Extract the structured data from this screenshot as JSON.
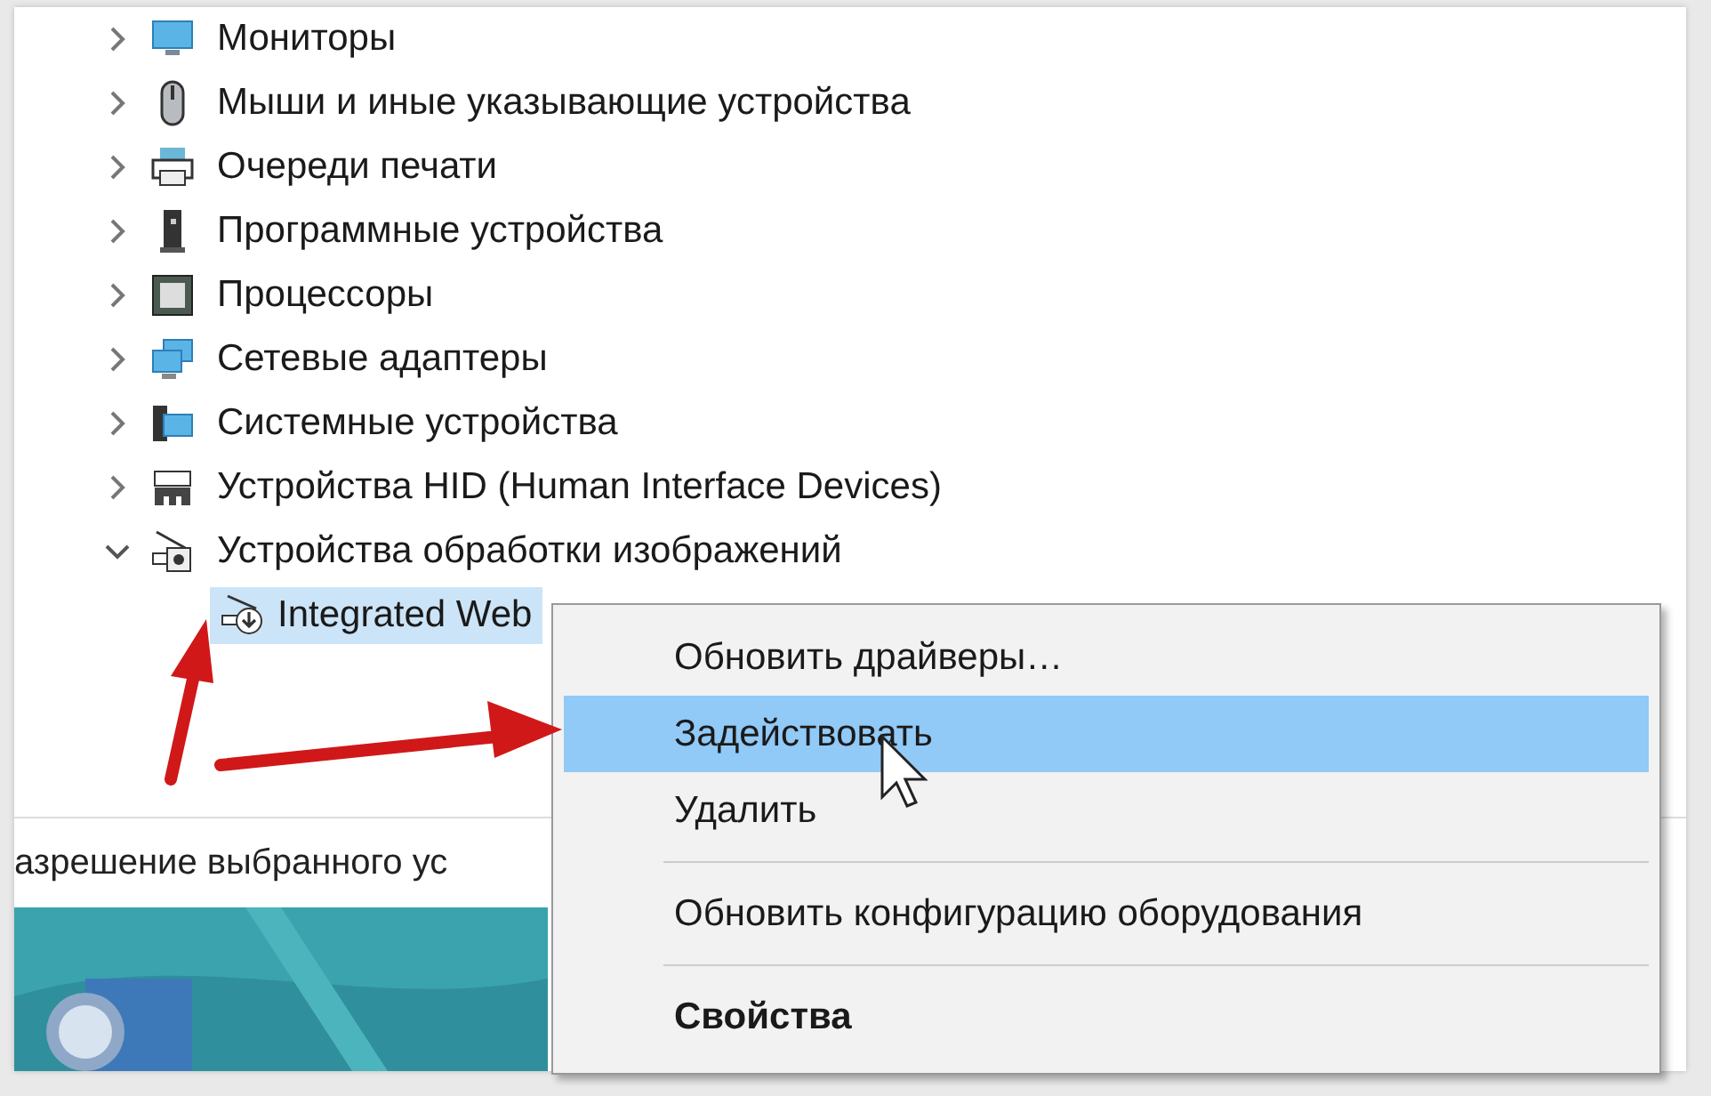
{
  "tree": {
    "items": [
      {
        "label": "Мониторы",
        "expanded": false,
        "selected": false
      },
      {
        "label": "Мыши и иные указывающие устройства",
        "expanded": false,
        "selected": false
      },
      {
        "label": "Очереди печати",
        "expanded": false,
        "selected": false
      },
      {
        "label": "Программные устройства",
        "expanded": false,
        "selected": false
      },
      {
        "label": "Процессоры",
        "expanded": false,
        "selected": false
      },
      {
        "label": "Сетевые адаптеры",
        "expanded": false,
        "selected": false
      },
      {
        "label": "Системные устройства",
        "expanded": false,
        "selected": false
      },
      {
        "label": "Устройства HID (Human Interface Devices)",
        "expanded": false,
        "selected": false
      },
      {
        "label": "Устройства обработки изображений",
        "expanded": true,
        "selected": false,
        "children": [
          {
            "label": "Integrated Web",
            "selected": true
          }
        ]
      }
    ]
  },
  "status_bar": {
    "text": "азрешение выбранного ус"
  },
  "context_menu": {
    "items": [
      {
        "kind": "item",
        "label": "Обновить драйверы…",
        "selected": false
      },
      {
        "kind": "item",
        "label": "Задействовать",
        "selected": true
      },
      {
        "kind": "item",
        "label": "Удалить",
        "selected": false
      },
      {
        "kind": "separator"
      },
      {
        "kind": "item",
        "label": "Обновить конфигурацию оборудования",
        "selected": false
      },
      {
        "kind": "separator"
      },
      {
        "kind": "default",
        "label": "Свойства",
        "selected": false
      }
    ]
  }
}
